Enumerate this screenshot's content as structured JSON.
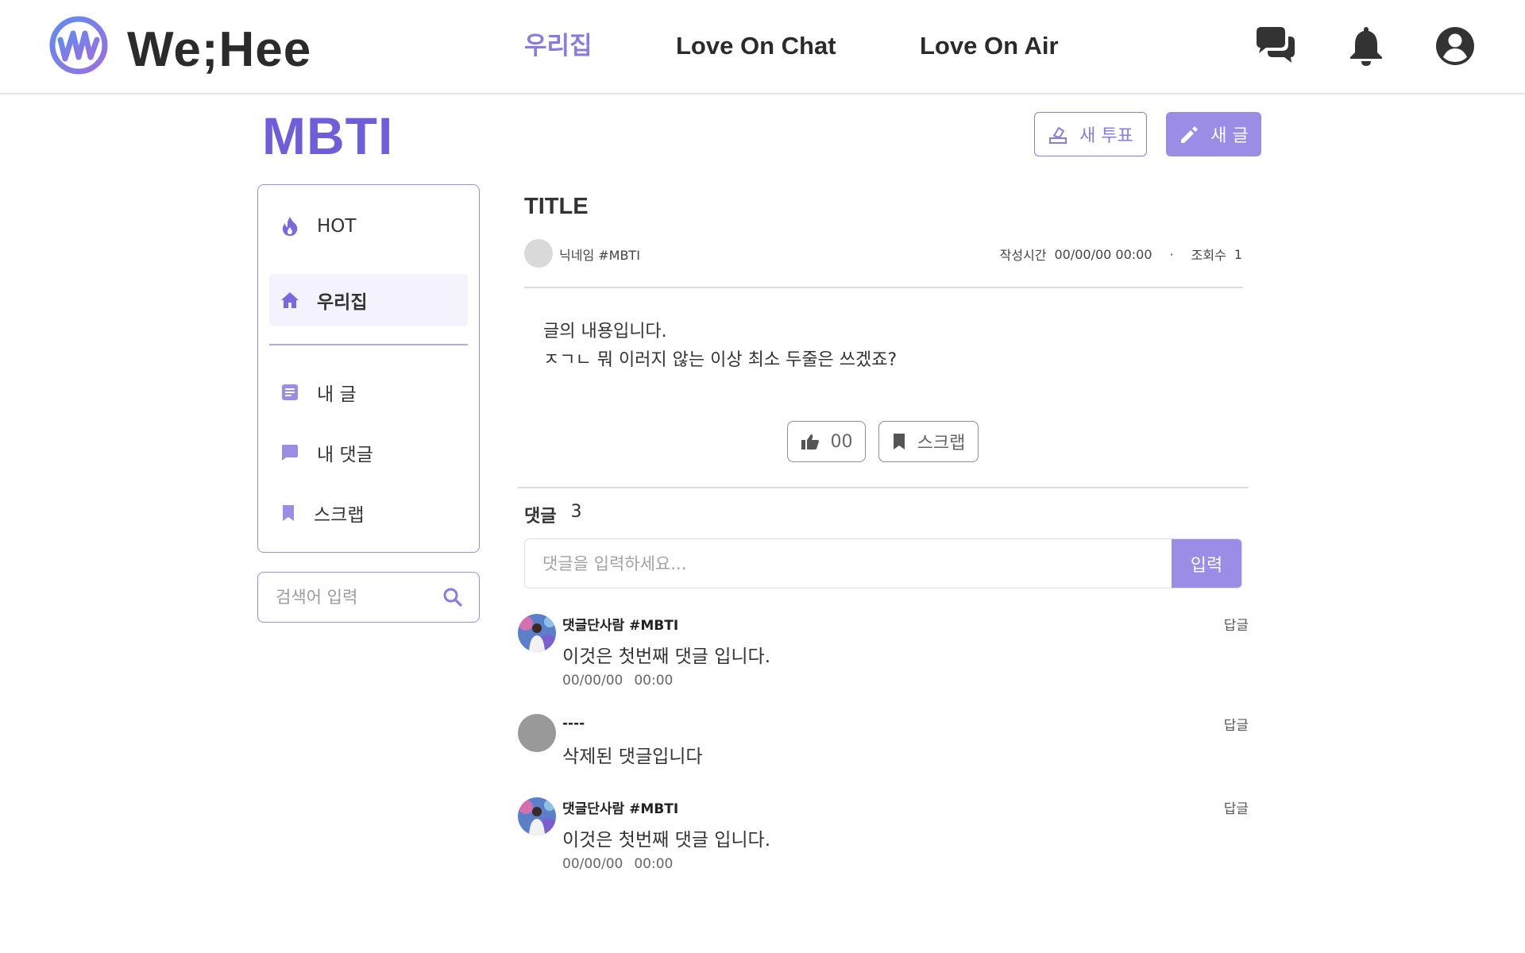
{
  "header": {
    "logo_text": "We;Hee",
    "nav": [
      {
        "label": "우리집",
        "active": true
      },
      {
        "label": "Love On Chat",
        "active": false
      },
      {
        "label": "Love On Air",
        "active": false
      }
    ],
    "icons": [
      "chat-icon",
      "bell-icon",
      "account-icon"
    ]
  },
  "board": {
    "title": "MBTI",
    "vote_button": "새 투표",
    "write_button": "새 글"
  },
  "sidebar": {
    "items": [
      {
        "label": "HOT",
        "icon": "fire-icon"
      },
      {
        "label": "우리집",
        "icon": "home-icon",
        "active": true
      },
      {
        "label": "내 글",
        "icon": "article-icon"
      },
      {
        "label": "내 댓글",
        "icon": "comment-icon"
      },
      {
        "label": "스크랩",
        "icon": "bookmark-icon"
      }
    ],
    "search_placeholder": "검색어 입력"
  },
  "post": {
    "title": "TITLE",
    "author": "닉네임 #MBTI",
    "created_label": "작성시간",
    "created_value": "00/00/00 00:00",
    "separator": "·",
    "views_label": "조회수",
    "views_value": "1",
    "body_lines": [
      "글의 내용입니다.",
      "ㅈㄱㄴ 뭐 이러지 않는 이상 최소 두줄은 쓰겠죠?"
    ],
    "like_count": "00",
    "scrap_label": "스크랩"
  },
  "comments": {
    "label": "댓글",
    "count": "3",
    "input_placeholder": "댓글을 입력하세요...",
    "submit_label": "입력",
    "items": [
      {
        "author": "댓글단사람 #MBTI",
        "text": "이것은 첫번째 댓글 입니다.",
        "date": "00/00/00",
        "time": "00:00",
        "reply": "답글",
        "deleted": false
      },
      {
        "author": "----",
        "text": "삭제된 댓글입니다",
        "date": "",
        "time": "",
        "reply": "답글",
        "deleted": true
      },
      {
        "author": "댓글단사람 #MBTI",
        "text": "이것은 첫번째 댓글 입니다.",
        "date": "00/00/00",
        "time": "00:00",
        "reply": "답글",
        "deleted": false
      }
    ]
  },
  "colors": {
    "accent": "#8b7ae0",
    "accent_dark": "#6e5ed9",
    "button_fill": "#9b8ce6",
    "text": "#333333"
  }
}
